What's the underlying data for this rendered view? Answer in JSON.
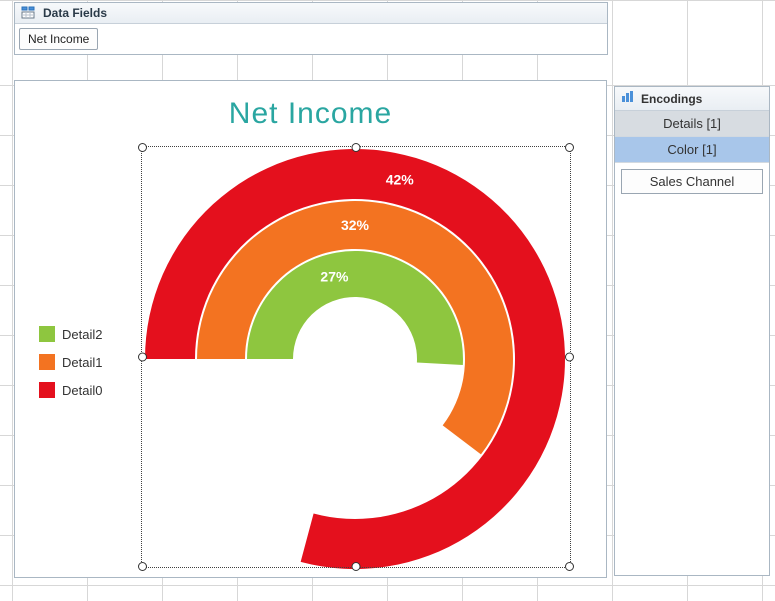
{
  "data_fields": {
    "title": "Data Fields",
    "items": [
      "Net Income"
    ]
  },
  "encodings": {
    "title": "Encodings",
    "details_label": "Details [1]",
    "color_label": "Color [1]",
    "items": [
      "Sales Channel"
    ]
  },
  "chart_data": {
    "type": "pie",
    "subtype": "nested-donut-radial-bar",
    "title": "Net Income",
    "max_percent": 100,
    "series": [
      {
        "name": "Detail0",
        "value": 42,
        "label": "42%",
        "color": "#e4101d"
      },
      {
        "name": "Detail1",
        "value": 32,
        "label": "32%",
        "color": "#f37321"
      },
      {
        "name": "Detail2",
        "value": 27,
        "label": "27%",
        "color": "#8ec63f"
      }
    ],
    "legend_order": [
      "Detail2",
      "Detail1",
      "Detail0"
    ],
    "legend_position": "left"
  }
}
